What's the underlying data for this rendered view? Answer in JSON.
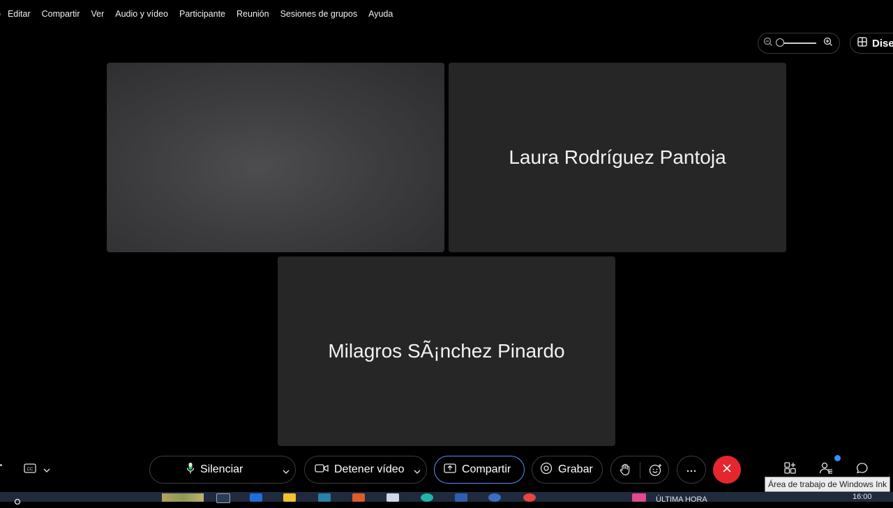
{
  "menu": [
    "o",
    "Editar",
    "Compartir",
    "Ver",
    "Audio y vídeo",
    "Participante",
    "Reunión",
    "Sesiones de grupos",
    "Ayuda"
  ],
  "layout_button": {
    "label": "Dise"
  },
  "tiles": {
    "laura": {
      "name": "Laura Rodríguez Pantoja"
    },
    "milagros": {
      "name": "Milagros SÃ¡nchez Pinardo"
    }
  },
  "controls": {
    "mute": {
      "label": "Silenciar"
    },
    "video": {
      "label": "Detener vídeo"
    },
    "share": {
      "label": "Compartir"
    },
    "record": {
      "label": "Grabar"
    }
  },
  "tooltip": "Área de trabajo de Windows Ink",
  "taskbar": {
    "clock": "16:00",
    "item_label": "ÚLTIMA HORA"
  },
  "colors": {
    "accent": "#5b8cff",
    "end_call": "#e5262e",
    "badge": "#3b8cff"
  }
}
